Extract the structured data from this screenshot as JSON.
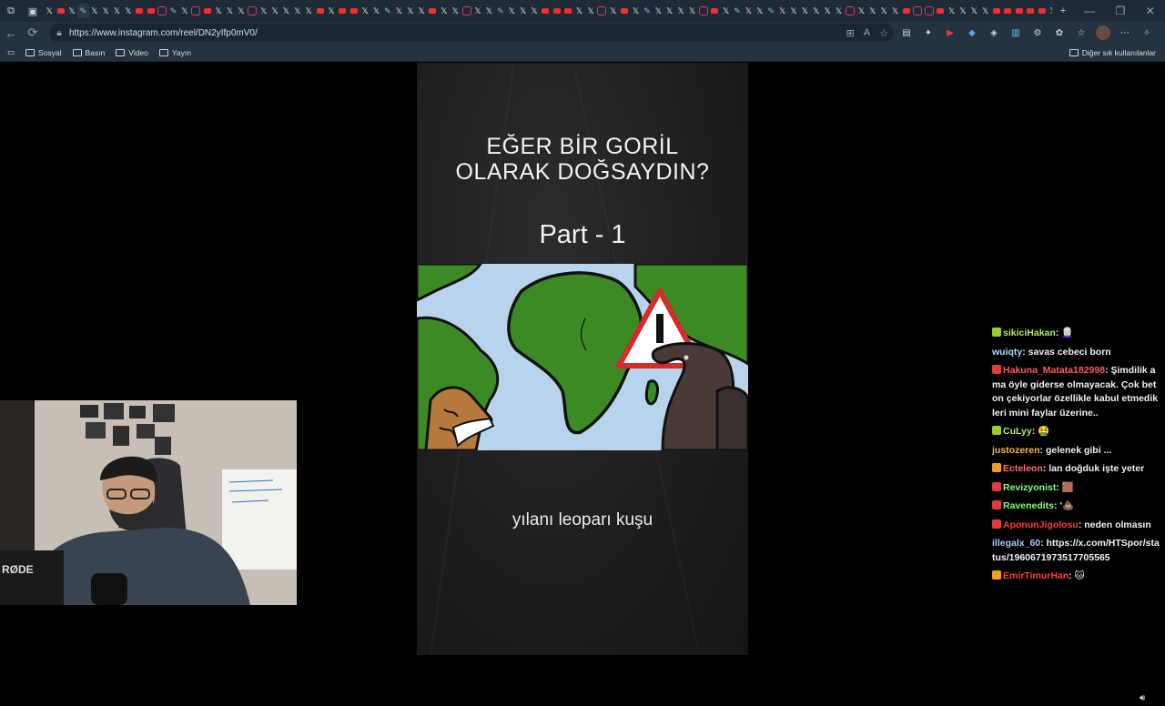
{
  "browser": {
    "tabs": [
      "x",
      "yt",
      "x",
      "pen",
      "x",
      "x",
      "x",
      "x",
      "yt",
      "yt",
      "ig",
      "pen",
      "x",
      "ig",
      "yt",
      "x",
      "x",
      "x",
      "ig",
      "x",
      "x",
      "x",
      "x",
      "x",
      "yt",
      "x",
      "yt",
      "yt",
      "x",
      "x",
      "pen",
      "x",
      "x",
      "x",
      "yt",
      "x",
      "x",
      "ig",
      "x",
      "x",
      "pen",
      "x",
      "x",
      "x",
      "yt",
      "yt",
      "yt",
      "x",
      "x",
      "ig",
      "x",
      "yt",
      "x",
      "pen",
      "x",
      "x",
      "x",
      "x",
      "ig",
      "yt",
      "x",
      "pen",
      "x",
      "x",
      "pen",
      "x",
      "x",
      "x",
      "x",
      "x",
      "x",
      "ig",
      "x",
      "x",
      "x",
      "x",
      "yt",
      "ig",
      "ig",
      "yt",
      "x",
      "x",
      "x",
      "x",
      "yt",
      "yt",
      "yt",
      "yt",
      "yt",
      "x",
      "pen"
    ],
    "url": "https://www.instagram.com/reel/DN2yIfp0mV0/",
    "bookmarks": [
      "Sosyal",
      "Basın",
      "Video",
      "Yayın"
    ],
    "bookmarks_right": "Diğer sık kullanılanlar"
  },
  "reel": {
    "title_line1": "EĞER BİR GORİL",
    "title_line2": "OLARAK DOĞSAYDIN?",
    "part": "Part - 1",
    "caption": "yılanı leoparı kuşu"
  },
  "chat": {
    "messages": [
      {
        "user": "sikiciHakan",
        "color": "#b5e86a",
        "text": "👩🏻‍🦳",
        "badge": "#9acd32"
      },
      {
        "user": "wuiqty",
        "color": "#a9d8ff",
        "text": "savas cebeci born",
        "badge": ""
      },
      {
        "user": "Hakuna_Matata182998",
        "color": "#ff5a5a",
        "text": "Şimdilik ama öyle giderse olmayacak. Çok beton çekiyorlar özellikle kabul etmedikleri mini faylar üzerine..",
        "badge": "#e23b3b"
      },
      {
        "user": "CuLyy",
        "color": "#b5e86a",
        "text": "🤮",
        "badge": "#9acd32"
      },
      {
        "user": "justozeren",
        "color": "#ffb347",
        "text": "gelenek gibi ...",
        "badge": ""
      },
      {
        "user": "Ecteleon",
        "color": "#ff6f6f",
        "text": "lan doğduk işte yeter",
        "badge": "#f0a020"
      },
      {
        "user": "Revizyonist",
        "color": "#7fff7f",
        "text": "🟫",
        "badge": "#e23b3b"
      },
      {
        "user": "Ravenedits",
        "color": "#7fff7f",
        "text": "'💩",
        "badge": "#e23b3b"
      },
      {
        "user": "AponunJigolosu",
        "color": "#ff3b3b",
        "text": "neden olmasın",
        "badge": "#e23b3b"
      },
      {
        "user": "illegalx_60",
        "color": "#a9c8ff",
        "text": "https://x.com/HTSpor/status/1960671973517705565",
        "badge": ""
      },
      {
        "user": "EmirTimurHan",
        "color": "#ff3b3b",
        "text": "🐱",
        "badge": "#f0a020"
      }
    ]
  },
  "colors": {
    "browser_bg": "#1f2a36",
    "toolbar_bg": "#25323f",
    "reel_bg": "#1d1d1d",
    "map_ocean": "#b8d4ec",
    "map_land": "#2f7d1f"
  }
}
